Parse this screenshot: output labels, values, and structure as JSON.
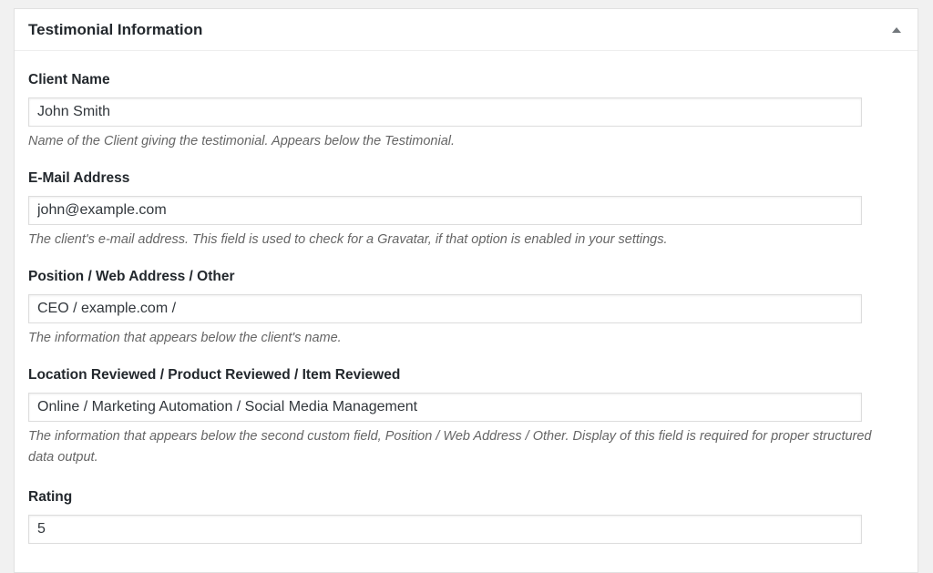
{
  "metabox": {
    "title": "Testimonial Information"
  },
  "fields": {
    "client_name": {
      "label": "Client Name",
      "value": "John Smith",
      "description": "Name of the Client giving the testimonial. Appears below the Testimonial."
    },
    "email": {
      "label": "E-Mail Address",
      "value": "john@example.com",
      "description": "The client's e-mail address. This field is used to check for a Gravatar, if that option is enabled in your settings."
    },
    "position": {
      "label": "Position / Web Address / Other",
      "value": "CEO / example.com /",
      "description": "The information that appears below the client's name."
    },
    "location": {
      "label": "Location Reviewed / Product Reviewed / Item Reviewed",
      "value": "Online / Marketing Automation / Social Media Management",
      "description": "The information that appears below the second custom field, Position / Web Address / Other. Display of this field is required for proper structured data output."
    },
    "rating": {
      "label": "Rating",
      "value": "5"
    }
  },
  "icons": {
    "toggle": "caret-up-icon"
  },
  "colors": {
    "page_background": "#f1f1f1",
    "panel_background": "#ffffff",
    "label_text": "#23282d",
    "description_text": "#666666",
    "input_border": "#dddddd"
  }
}
